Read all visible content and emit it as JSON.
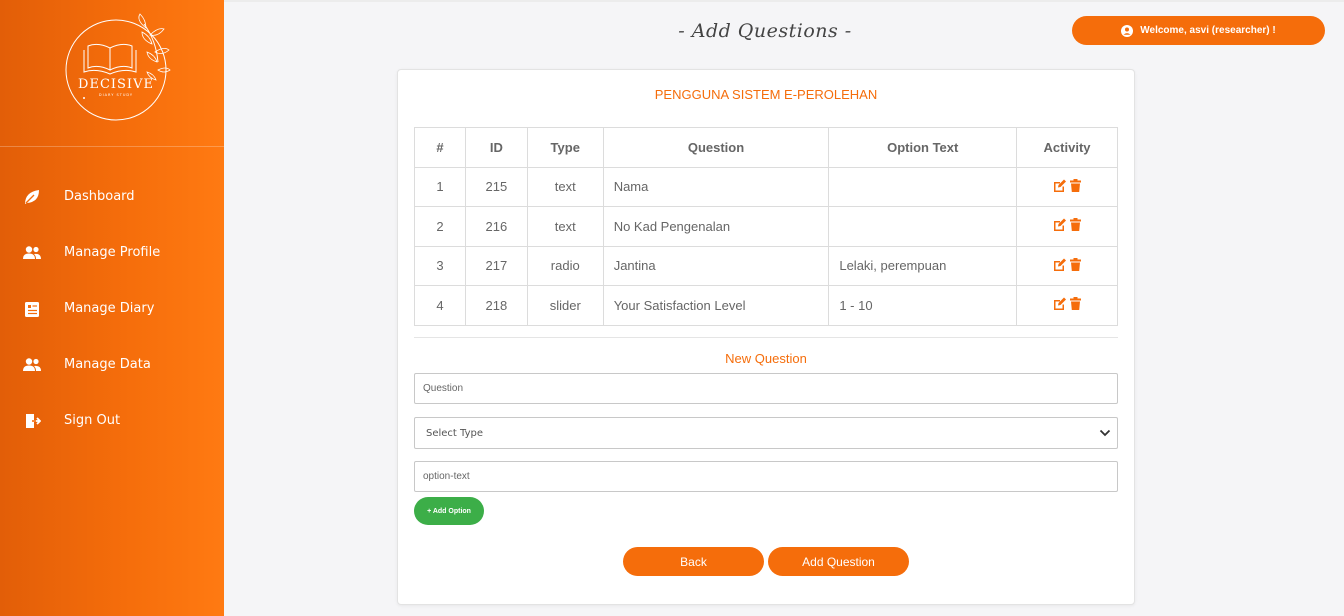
{
  "brand": {
    "logo_text": "DECISIVE",
    "logo_subtext": "DIARY STUDY"
  },
  "sidebar": {
    "items": [
      {
        "label": "Dashboard",
        "icon": "leaf-icon"
      },
      {
        "label": "Manage Profile",
        "icon": "users-icon"
      },
      {
        "label": "Manage Diary",
        "icon": "diary-icon"
      },
      {
        "label": "Manage Data",
        "icon": "users-icon"
      },
      {
        "label": "Sign Out",
        "icon": "sign-out-icon"
      }
    ]
  },
  "header": {
    "title": "- Add Questions -",
    "welcome": "Welcome, asvi (researcher) !"
  },
  "card": {
    "title": "PENGGUNA SISTEM E-PEROLEHAN",
    "table": {
      "headers": [
        "#",
        "ID",
        "Type",
        "Question",
        "Option Text",
        "Activity"
      ],
      "rows": [
        {
          "num": "1",
          "id": "215",
          "type": "text",
          "question": "Nama",
          "option": ""
        },
        {
          "num": "2",
          "id": "216",
          "type": "text",
          "question": "No Kad Pengenalan",
          "option": ""
        },
        {
          "num": "3",
          "id": "217",
          "type": "radio",
          "question": "Jantina",
          "option": "Lelaki, perempuan"
        },
        {
          "num": "4",
          "id": "218",
          "type": "slider",
          "question": "Your Satisfaction Level",
          "option": "1 - 10"
        }
      ]
    },
    "new_question": {
      "heading": "New Question",
      "question_placeholder": "Question",
      "type_selected": "Select Type",
      "option_placeholder": "option-text",
      "add_option_label": "+ Add Option"
    },
    "buttons": {
      "back": "Back",
      "add_question": "Add Question"
    }
  },
  "colors": {
    "accent": "#f56d0b",
    "success": "#3cae48"
  }
}
